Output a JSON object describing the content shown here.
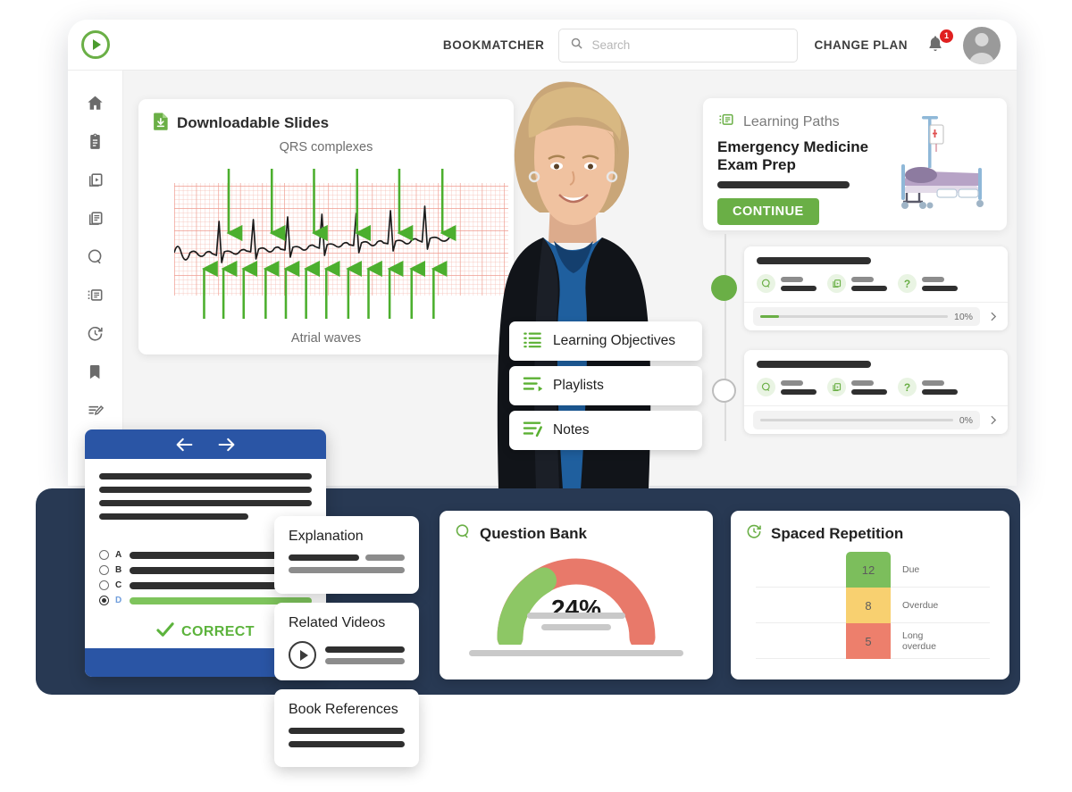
{
  "header": {
    "brand": "BOOKMATCHER",
    "search_placeholder": "Search",
    "search_value": "",
    "change_plan": "CHANGE PLAN",
    "notification_count": "1"
  },
  "sidebar": {
    "items": [
      {
        "icon": "home-icon"
      },
      {
        "icon": "clipboard-icon"
      },
      {
        "icon": "video-library-icon"
      },
      {
        "icon": "documents-icon"
      },
      {
        "icon": "question-bank-icon"
      },
      {
        "icon": "learning-paths-icon"
      },
      {
        "icon": "spaced-repetition-icon"
      },
      {
        "icon": "bookmark-icon"
      },
      {
        "icon": "notes-icon"
      },
      {
        "icon": "analytics-icon"
      }
    ]
  },
  "slides_card": {
    "title": "Downloadable Slides",
    "icon": "download-file-icon",
    "chart_top_label": "QRS complexes",
    "chart_bottom_label": "Atrial waves"
  },
  "learning_paths": {
    "section_label": "Learning Paths",
    "icon": "learning-paths-icon",
    "course_title": "Emergency Medicine\nExam Prep",
    "continue_label": "CONTINUE",
    "illustration": "hospital-bed-icon"
  },
  "courses": [
    {
      "progress_label": "10%",
      "progress_value": 10,
      "state": "active"
    },
    {
      "progress_label": "0%",
      "progress_value": 0,
      "state": "inactive"
    }
  ],
  "float_menu": [
    {
      "label": "Learning Objectives",
      "icon": "list-icon"
    },
    {
      "label": "Playlists",
      "icon": "playlist-icon"
    },
    {
      "label": "Notes",
      "icon": "notes-icon"
    }
  ],
  "quiz": {
    "options": [
      "A",
      "B",
      "C",
      "D"
    ],
    "selected": "D",
    "result_label": "CORRECT",
    "prev_icon": "arrow-left-icon",
    "next_icon": "arrow-right-icon"
  },
  "mini_cards": [
    {
      "title": "Explanation"
    },
    {
      "title": "Related Videos",
      "icon": "play-icon"
    },
    {
      "title": "Book References"
    }
  ],
  "question_bank": {
    "title": "Question Bank",
    "icon": "question-bank-icon"
  },
  "spaced_repetition": {
    "title": "Spaced Repetition",
    "icon": "spaced-repetition-icon"
  },
  "colors": {
    "green": "#6aaf46",
    "navy": "#283953",
    "blue": "#2a55a5",
    "red": "#e8796a",
    "yellow": "#f8d070",
    "badge_red": "#e02020"
  },
  "chart_data": [
    {
      "type": "line",
      "name": "ecg-strip",
      "title": "Downloadable Slides",
      "annotations": [
        "QRS complexes",
        "Atrial waves"
      ],
      "qrs_arrow_count": 6,
      "atrial_arrow_count": 11,
      "xlabel": "",
      "ylabel": "",
      "grid": true,
      "grid_color": "#f0a9a0"
    },
    {
      "type": "pie",
      "name": "question-bank-gauge",
      "title": "Question Bank",
      "value_label": "24%",
      "categories": [
        "Completed",
        "Remaining"
      ],
      "values": [
        24,
        76
      ],
      "colors": [
        "#8dc765",
        "#e8796a"
      ],
      "ylim": [
        0,
        100
      ]
    },
    {
      "type": "bar",
      "name": "spaced-repetition",
      "title": "Spaced Repetition",
      "categories": [
        "Due",
        "Overdue",
        "Long overdue"
      ],
      "values": [
        12,
        8,
        5
      ],
      "value_labels": [
        "12",
        "8",
        "5"
      ],
      "colors": [
        "#7cbe5c",
        "#f8d070",
        "#ed7f6c"
      ],
      "grid": true,
      "xlabel": "",
      "ylabel": ""
    }
  ]
}
